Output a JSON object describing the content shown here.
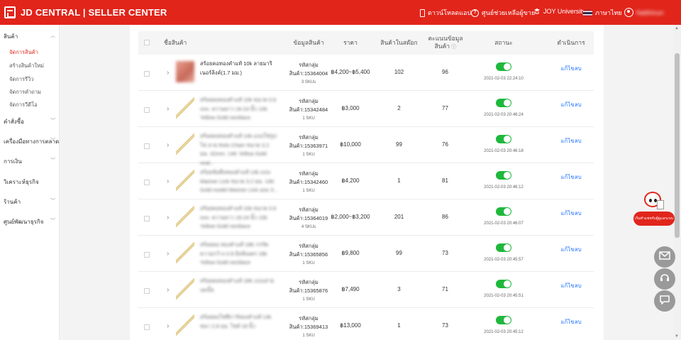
{
  "header": {
    "brand": "JD CENTRAL | SELLER CENTER",
    "download_app": "ดาวน์โหลดแอป",
    "help_center": "ศูนย์ช่วยเหลือผู้ขาย",
    "university": "JOY University",
    "language": "ภาษาไทย",
    "username": "Natthinun",
    "colors": {
      "brand_red": "#e1251b",
      "toggle_green": "#1fb83c",
      "link_blue": "#2775ff"
    }
  },
  "sidebar": {
    "sections": [
      {
        "label": "สินค้า",
        "expanded": true,
        "items": [
          "จัดการสินค้า",
          "สร้างสินค้าใหม่",
          "จัดการรีวิว",
          "จัดการคำถาม",
          "จัดการวีดีโอ"
        ]
      },
      {
        "label": "คำสั่งซื้อ"
      },
      {
        "label": "เครื่องมือทางการตลาด"
      },
      {
        "label": "การเงิน"
      },
      {
        "label": "วิเคราะห์ธุรกิจ"
      },
      {
        "label": "ร้านค้า"
      },
      {
        "label": "ศูนย์พัฒนาธุรกิจ"
      }
    ],
    "active_item": "จัดการสินค้า"
  },
  "table": {
    "headers": {
      "product_name": "ชื่อสินค้า",
      "product_info": "ข้อมูลสินค้า",
      "price": "ราคา",
      "stock": "สินค้าในสต๊อก",
      "score": "คะแนนข้อมูลสินค้า",
      "status": "สถานะ",
      "action": "ดำเนินการ"
    },
    "rows": [
      {
        "name": "สร้อยคอทองคำแท้ 10k ลายมาริเนอร์ลิงค์(1.7 มม.)",
        "group_label": "รหัสกลุ่ม",
        "group_id": "สินค้า:15364004",
        "sku": "3 SKUs",
        "price": "฿4,200~฿5,400",
        "stock": "102",
        "score": "96",
        "date": "2021-02-03 22:24:10",
        "action": "แก้ไขลบ"
      },
      {
        "name": "สร้อยคอทองคำแท้ 10k ขนาด 0.6 mm. ความยาว 16-24 นิ้ว 10k Yellow Gold necklace",
        "group_label": "รหัสกลุ่ม",
        "group_id": "สินค้า:15342484",
        "sku": "1 SKU",
        "price": "฿3,000",
        "stock": "2",
        "score": "77",
        "date": "2021-02-03 20:46:24",
        "action": "แก้ไขลบ"
      },
      {
        "name": "สร้อยคอทองคำแท้ 14k แบบโซ่รูปไข่ ลาย Rolo Chain ขนาด 3.2 มม. 32mm. 14K Yellow Gold oval...",
        "group_label": "รหัสกลุ่ม",
        "group_id": "สินค้า:15363971",
        "sku": "1 SKU",
        "price": "฿10,000",
        "stock": "99",
        "score": "76",
        "date": "2021-02-03 20:46:18",
        "action": "แก้ไขลบ"
      },
      {
        "name": "สร้อยข้อมือทองคำแท้ 14k แบบ Mariner Link ขนาด 3.2 มม. 14K Gold model Mariner Link size 3...",
        "group_label": "รหัสกลุ่ม",
        "group_id": "สินค้า:15342460",
        "sku": "1 SKU",
        "price": "฿4,200",
        "stock": "1",
        "score": "81",
        "date": "2021-02-03 20:46:12",
        "action": "แก้ไขลบ"
      },
      {
        "name": "สร้อยคอทองคำแท้ 10k ขนาด 0.6 mm. ความยาว 16-24 นิ้ว 10k Yellow Gold necklace",
        "group_label": "รหัสกลุ่ม",
        "group_id": "สินค้า:15364019",
        "sku": "4 SKUs",
        "price": "฿2,000~฿3,200",
        "stock": "201",
        "score": "86",
        "date": "2021-02-03 20:46:07",
        "action": "แก้ไขลบ"
      },
      {
        "name": "สร้อยคอ ทองคำแท้ 18K กรรัต ความกว้าง 0.8 มิลลิเมตร 18k Yellow Gold necklace",
        "group_label": "รหัสกลุ่ม",
        "group_id": "สินค้า:15365856",
        "sku": "1 SKU",
        "price": "฿9,800",
        "stock": "99",
        "score": "73",
        "date": "2021-02-03 20:45:57",
        "action": "แก้ไขลบ"
      },
      {
        "name": "สร้อยคอทองคำแท้ 18K แบบสายเคเบิ้ล",
        "group_label": "รหัสกลุ่ม",
        "group_id": "สินค้า:15365876",
        "sku": "1 SKU",
        "price": "฿7,490",
        "stock": "3",
        "score": "71",
        "date": "2021-02-03 20:45:51",
        "action": "แก้ไขลบ"
      },
      {
        "name": "สร้อยคอโซฟีการ์ทองคำแท้ 14k หนา 2.8 มม. ไซส์ 18 นิ้ว",
        "group_label": "รหัสกลุ่ม",
        "group_id": "สินค้า:15369413",
        "sku": "1 SKU",
        "price": "฿13,000",
        "stock": "1",
        "score": "73",
        "date": "2021-02-03 20:45:12",
        "action": "แก้ไขลบ"
      }
    ]
  },
  "widgets": {
    "chat_label": "เริ่มทำแชทกับผู้ดูแลระบบ"
  }
}
